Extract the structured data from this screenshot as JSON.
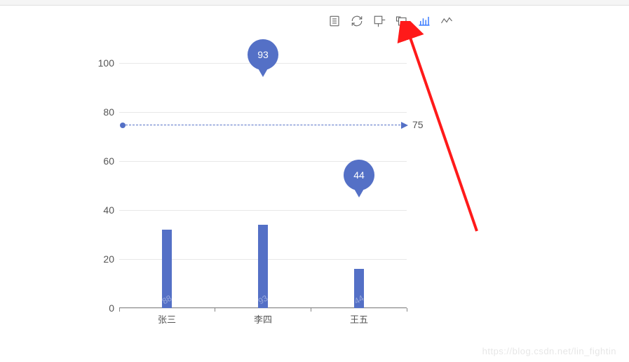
{
  "toolbar": {
    "icons": [
      {
        "name": "data-view-icon",
        "active": false
      },
      {
        "name": "refresh-icon",
        "active": false
      },
      {
        "name": "zoom-select-icon",
        "active": false
      },
      {
        "name": "zoom-reset-icon",
        "active": false
      },
      {
        "name": "bar-chart-icon",
        "active": true
      },
      {
        "name": "line-chart-icon",
        "active": false
      }
    ]
  },
  "chart_data": {
    "type": "bar",
    "categories": [
      "张三",
      "李四",
      "王五"
    ],
    "values": [
      88,
      93,
      44
    ],
    "bar_visual_heights": [
      32,
      34,
      16
    ],
    "title": "",
    "xlabel": "",
    "ylabel": "",
    "ylim": [
      0,
      100
    ],
    "y_ticks": [
      0,
      20,
      40,
      60,
      80,
      100
    ],
    "markpoints": [
      {
        "type": "max",
        "value": 93,
        "category": "李四"
      },
      {
        "type": "min",
        "value": 44,
        "category": "王五"
      }
    ],
    "marklines": [
      {
        "type": "average",
        "value": 75
      }
    ]
  },
  "markpoint_max_label": "93",
  "markpoint_min_label": "44",
  "markline_label": "75",
  "watermark": "https://blog.csdn.net/lin_fightin",
  "bar_labels": {
    "b0": "88",
    "b1": "93",
    "b2": "44"
  },
  "y_labels": {
    "y0": "0",
    "y20": "20",
    "y40": "40",
    "y60": "60",
    "y80": "80",
    "y100": "100"
  },
  "x_labels": {
    "x0": "张三",
    "x1": "李四",
    "x2": "王五"
  }
}
